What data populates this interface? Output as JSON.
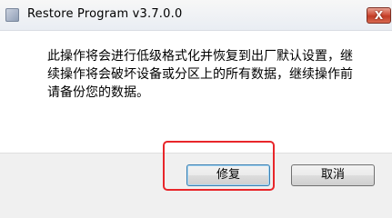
{
  "window": {
    "title": "Restore Program v3.7.0.0",
    "close_glyph": "X",
    "app_icon": "app-icon"
  },
  "dialog": {
    "message": "此操作将会进行低级格式化并恢复到出厂默认设置，继续操作将会破坏设备或分区上的所有数据，继续操作前请备份您的数据。"
  },
  "buttons": {
    "restore_label": "修复",
    "cancel_label": "取消"
  },
  "annotation": {
    "highlight_color": "#e8262a"
  }
}
